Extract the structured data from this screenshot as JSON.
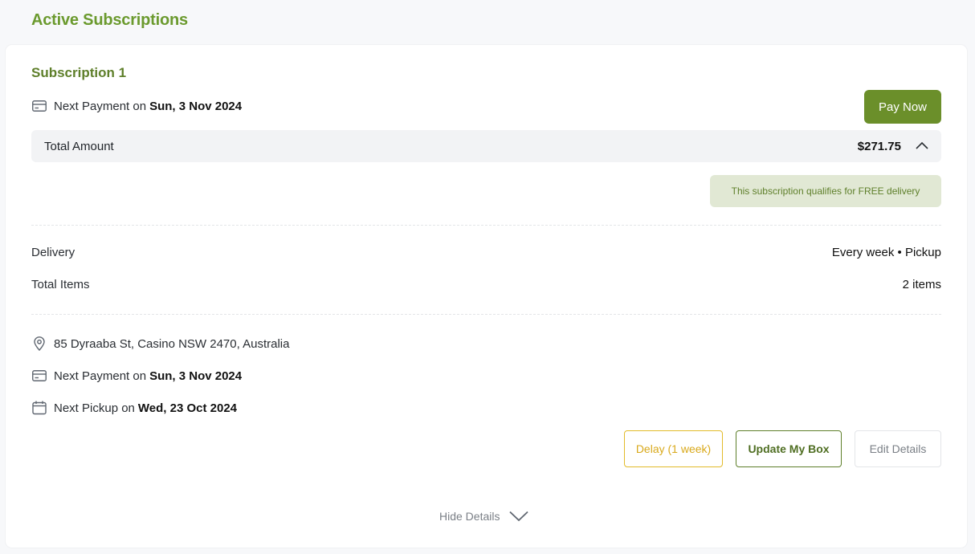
{
  "page": {
    "title": "Active Subscriptions"
  },
  "subscription": {
    "title": "Subscription 1",
    "next_payment_label": "Next Payment on",
    "next_payment_date": "Sun, 3 Nov 2024",
    "pay_now_label": "Pay Now",
    "total_label": "Total Amount",
    "total_amount": "$271.75",
    "free_delivery_text": "This subscription qualifies for FREE delivery",
    "delivery_label": "Delivery",
    "delivery_value": "Every week • Pickup",
    "items_label": "Total Items",
    "items_value": "2 items",
    "address": "85 Dyraaba St, Casino NSW 2470, Australia",
    "payment2_label": "Next Payment on",
    "payment2_date": "Sun, 3 Nov 2024",
    "pickup_label": "Next Pickup on",
    "pickup_date": "Wed, 23 Oct 2024",
    "delay_label": "Delay (1 week)",
    "update_label": "Update My Box",
    "edit_label": "Edit Details",
    "hide_details_label": "Hide Details"
  },
  "icons": {
    "payment": "credit-card-icon",
    "location": "location-pin-icon",
    "calendar": "calendar-icon",
    "collapse": "chevron-up-icon",
    "hide": "chevron-down-icon"
  },
  "colors": {
    "brand_green": "#6b8f2a",
    "title_green": "#6b9a2e",
    "delay_yellow": "#e2bb2a",
    "badge_bg": "#e1e8d4"
  }
}
